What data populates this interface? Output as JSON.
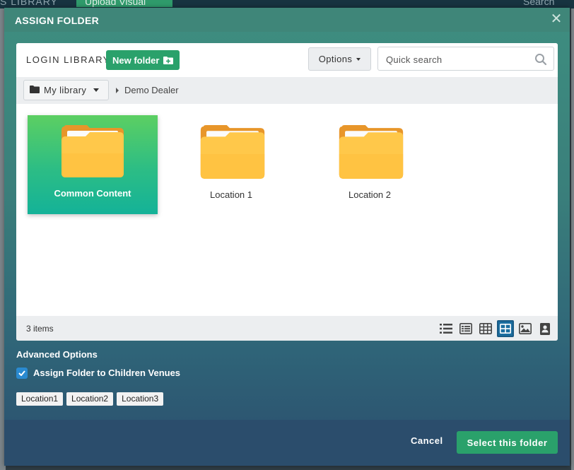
{
  "background": {
    "library_label": "S LIBRARY",
    "upload_label": "Upload Visual",
    "search_label": "Search"
  },
  "modal": {
    "title": "ASSIGN FOLDER",
    "close_icon": "close-icon"
  },
  "toolbar": {
    "library_label": "LOGIN LIBRARY",
    "new_folder_label": "New folder",
    "options_label": "Options",
    "search_placeholder": "Quick search"
  },
  "breadcrumb": {
    "root_label": "My library",
    "current": "Demo Dealer"
  },
  "folders": [
    {
      "name": "Common Content",
      "selected": true
    },
    {
      "name": "Location 1",
      "selected": false
    },
    {
      "name": "Location 2",
      "selected": false
    }
  ],
  "footer": {
    "items_count": "3 items",
    "view_modes": [
      "list-icon",
      "detail-list-icon",
      "table-icon",
      "grid-icon",
      "image-icon",
      "contact-card-icon"
    ],
    "active_view": "grid-icon"
  },
  "advanced": {
    "title": "Advanced Options",
    "checkbox_label": "Assign Folder to Children Venues",
    "checked": true,
    "tags": [
      "Location1",
      "Location2",
      "Location3"
    ]
  },
  "actions": {
    "cancel_label": "Cancel",
    "select_label": "Select this folder"
  },
  "colors": {
    "accent_green": "#2aa16b",
    "header_teal": "#3f8679",
    "folder_yellow": "#ffc84a",
    "active_view_blue": "#1b6ea0"
  }
}
